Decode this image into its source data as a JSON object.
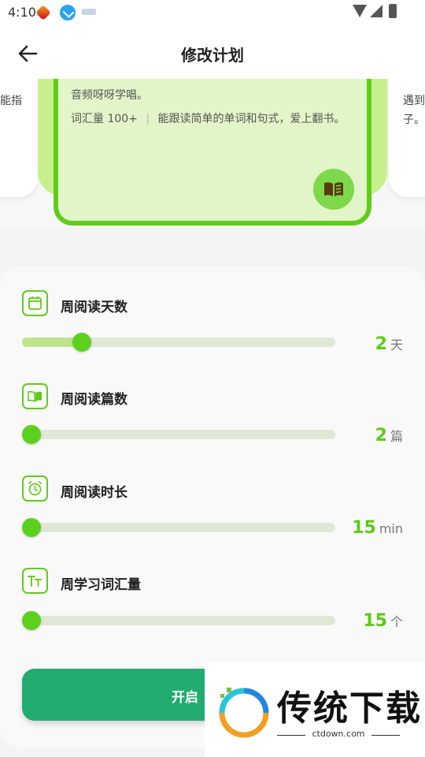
{
  "status_bar": {
    "time": "4:10"
  },
  "header": {
    "title": "修改计划"
  },
  "carousel": {
    "left_card_text": "能指",
    "right_card_text": "遇到子。",
    "center_card": {
      "line1": "音频呀呀学唱。",
      "vocab_tag": "词汇量 100+",
      "description": "能跟读简单的单词和句式，爱上翻书。"
    }
  },
  "settings": [
    {
      "label": "周阅读天数",
      "value": "2",
      "unit": "天",
      "level": 0.17,
      "icon": "calendar-icon"
    },
    {
      "label": "周阅读篇数",
      "value": "2",
      "unit": "篇",
      "level": 0.0,
      "icon": "open-book-icon"
    },
    {
      "label": "周阅读时长",
      "value": "15",
      "unit": "min",
      "level": 0.0,
      "icon": "alarm-clock-icon"
    },
    {
      "label": "周学习词汇量",
      "value": "15",
      "unit": "个",
      "level": 0.0,
      "icon": "text-size-icon"
    }
  ],
  "start_button": {
    "label": "开启"
  },
  "watermark": {
    "title": "传统下载",
    "subtitle": "ctdown.com"
  },
  "colors": {
    "accent": "#5bcc14",
    "button": "#22ac6f",
    "card_border": "#5fcc1a",
    "card_bg": "#e2f5c8"
  }
}
